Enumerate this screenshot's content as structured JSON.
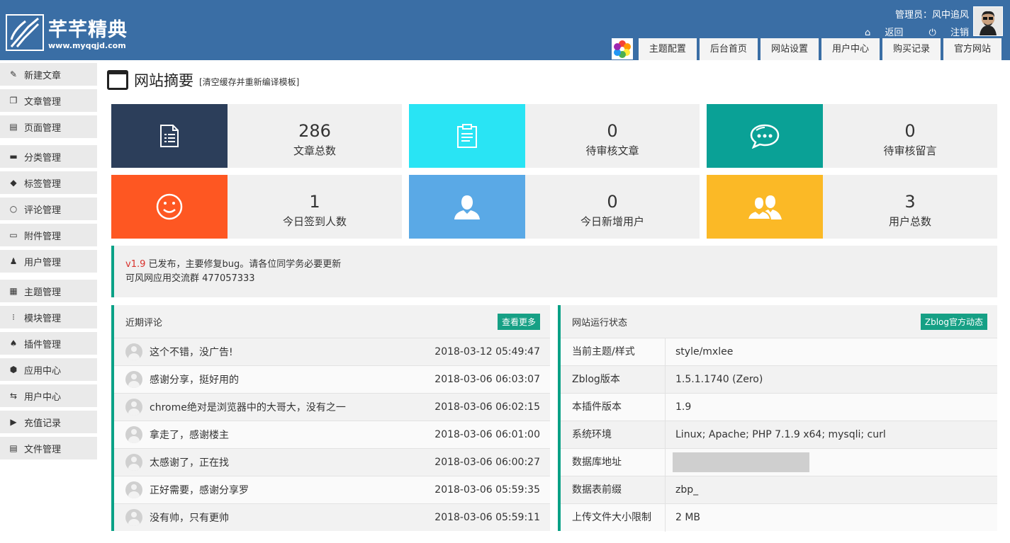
{
  "header": {
    "logo_title": "芊芊精典",
    "logo_url": "www.myqqjd.com",
    "admin_label": "管理员：风中追风",
    "back_label": "返回",
    "logout_label": "注销"
  },
  "topnav": [
    "主题配置",
    "后台首页",
    "网站设置",
    "用户中心",
    "购买记录",
    "官方网站"
  ],
  "sidebar": [
    {
      "icon": "edit-icon",
      "label": "新建文章"
    },
    {
      "icon": "copy-icon",
      "label": "文章管理"
    },
    {
      "icon": "pages-icon",
      "label": "页面管理"
    },
    {
      "icon": "folder-icon",
      "label": "分类管理"
    },
    {
      "icon": "tag-icon",
      "label": "标签管理"
    },
    {
      "icon": "comment-icon",
      "label": "评论管理"
    },
    {
      "icon": "attachment-icon",
      "label": "附件管理"
    },
    {
      "icon": "user-icon",
      "label": "用户管理"
    },
    {
      "icon": "theme-icon",
      "label": "主题管理"
    },
    {
      "icon": "module-icon",
      "label": "模块管理"
    },
    {
      "icon": "plugin-icon",
      "label": "插件管理"
    },
    {
      "icon": "app-icon",
      "label": "应用中心"
    },
    {
      "icon": "exchange-icon",
      "label": "用户中心"
    },
    {
      "icon": "play-icon",
      "label": "充值记录"
    },
    {
      "icon": "file-icon",
      "label": "文件管理"
    }
  ],
  "page": {
    "title": "网站摘要",
    "note": "[清空缓存并重新编译模板]"
  },
  "stats": [
    {
      "value": "286",
      "label": "文章总数",
      "color": "#2c3e5a",
      "icon": "document-list-icon"
    },
    {
      "value": "0",
      "label": "待审核文章",
      "color": "#29e4f4",
      "icon": "clipboard-icon"
    },
    {
      "value": "0",
      "label": "待审核留言",
      "color": "#0aa196",
      "icon": "chat-bubble-icon"
    },
    {
      "value": "1",
      "label": "今日签到人数",
      "color": "#fe5722",
      "icon": "smile-icon"
    },
    {
      "value": "0",
      "label": "今日新增用户",
      "color": "#5aa9e6",
      "icon": "user-silhouette-icon"
    },
    {
      "value": "3",
      "label": "用户总数",
      "color": "#fbb926",
      "icon": "users-icon"
    }
  ],
  "notice": {
    "version": "v1.9",
    "line1": "已发布，主要修复bug。请各位同学务必要更新",
    "line2": "可风网应用交流群 477057333"
  },
  "comments": {
    "title": "近期评论",
    "more_label": "查看更多",
    "items": [
      {
        "text": "这个不错，没广告!",
        "time": "2018-03-12 05:49:47"
      },
      {
        "text": "感谢分享，挺好用的",
        "time": "2018-03-06 06:03:07"
      },
      {
        "text": "chrome绝对是浏览器中的大哥大，没有之一",
        "time": "2018-03-06 06:02:15"
      },
      {
        "text": "拿走了，感谢楼主",
        "time": "2018-03-06 06:01:00"
      },
      {
        "text": "太感谢了，正在找",
        "time": "2018-03-06 06:00:27"
      },
      {
        "text": "正好需要，感谢分享罗",
        "time": "2018-03-06 05:59:35"
      },
      {
        "text": "没有帅，只有更帅",
        "time": "2018-03-06 05:59:11"
      }
    ]
  },
  "status": {
    "title": "网站运行状态",
    "more_label": "Zblog官方动态",
    "items": [
      {
        "key": "当前主题/样式",
        "value": "style/mxlee"
      },
      {
        "key": "Zblog版本",
        "value": "1.5.1.1740 (Zero)"
      },
      {
        "key": "本插件版本",
        "value": "1.9"
      },
      {
        "key": "系统环境",
        "value": "Linux; Apache; PHP 7.1.9 x64; mysqli; curl"
      },
      {
        "key": "数据库地址",
        "value": ""
      },
      {
        "key": "数据表前缀",
        "value": "zbp_"
      },
      {
        "key": "上传文件大小限制",
        "value": "2 MB"
      }
    ]
  }
}
